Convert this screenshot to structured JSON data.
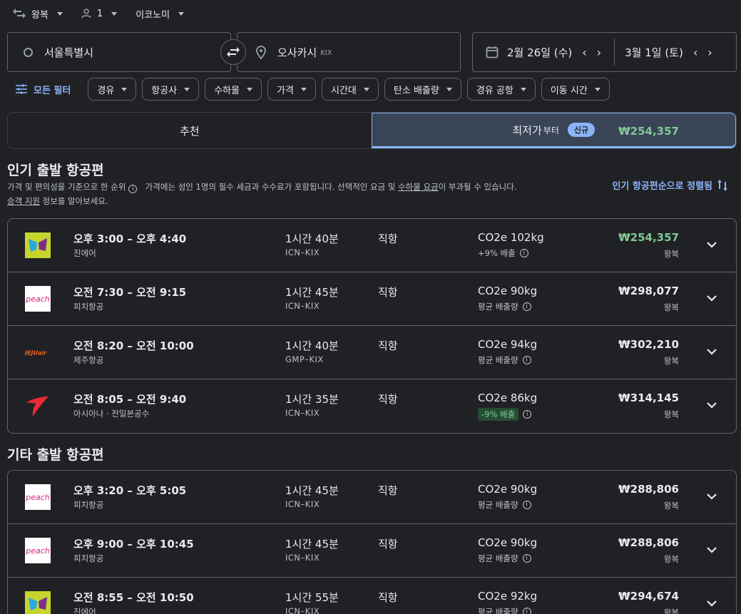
{
  "trip": {
    "type": "왕복",
    "passengers": "1",
    "cabin": "이코노미"
  },
  "search": {
    "origin": "서울특별시",
    "destination": "오사카시",
    "destination_code": "KIX",
    "depart_date": "2월 26일 (수)",
    "return_date": "3월 1일 (토)"
  },
  "filters": {
    "all": "모든 필터",
    "chips": [
      "경유",
      "항공사",
      "수하물",
      "가격",
      "시간대",
      "탄소 배출량",
      "경유 공항",
      "이동 시간"
    ]
  },
  "tabs": {
    "recommended": "추천",
    "cheapest": "최저가",
    "cheapest_price": "₩254,357",
    "cheapest_from": "부터",
    "new_badge": "신규"
  },
  "popular": {
    "title": "인기 출발 항공편",
    "sub_1": "가격 및 편의성을 기준으로 한 순위",
    "sub_2": "가격에는 성인 1명의 필수 세금과 수수료가 포함됩니다. 선택적인 요금 및",
    "sub_link_bag": "수하물 요금",
    "sub_3": "이 부과될 수 있습니다.",
    "sub_link_assist": "승객 지원",
    "sub_4": "정보를 알아보세요.",
    "sort": "인기 항공편순으로 정렬됨"
  },
  "other": {
    "title": "기타 출발 항공편"
  },
  "flights_popular": [
    {
      "times": "오후 3:00 – 오후 4:40",
      "airline": "진에어",
      "logo": "jinair",
      "duration": "1시간 40분",
      "route": "ICN–KIX",
      "stops": "직항",
      "co2": "CO2e 102kg",
      "co2_note": "+9% 배출",
      "price": "₩254,357",
      "price_type": "왕복",
      "green": true
    },
    {
      "times": "오전 7:30 – 오전 9:15",
      "airline": "피치항공",
      "logo": "peach",
      "duration": "1시간 45분",
      "route": "ICN–KIX",
      "stops": "직항",
      "co2": "CO2e 90kg",
      "co2_note": "평균 배출량",
      "price": "₩298,077",
      "price_type": "왕복"
    },
    {
      "times": "오전 8:20 – 오전 10:00",
      "airline": "제주항공",
      "logo": "jejuair",
      "duration": "1시간 40분",
      "route": "GMP–KIX",
      "stops": "직항",
      "co2": "CO2e 94kg",
      "co2_note": "평균 배출량",
      "price": "₩302,210",
      "price_type": "왕복"
    },
    {
      "times": "오전 8:05 – 오전 9:40",
      "airline": "아시아나 · 전일본공수",
      "logo": "asiana",
      "duration": "1시간 35분",
      "route": "ICN–KIX",
      "stops": "직항",
      "co2": "CO2e 86kg",
      "co2_note": "-9% 배출",
      "low": true,
      "price": "₩314,145",
      "price_type": "왕복"
    }
  ],
  "flights_other": [
    {
      "times": "오후 3:20 – 오후 5:05",
      "airline": "피치항공",
      "logo": "peach",
      "duration": "1시간 45분",
      "route": "ICN–KIX",
      "stops": "직항",
      "co2": "CO2e 90kg",
      "co2_note": "평균 배출량",
      "price": "₩288,806",
      "price_type": "왕복"
    },
    {
      "times": "오후 9:00 – 오후 10:45",
      "airline": "피치항공",
      "logo": "peach",
      "duration": "1시간 45분",
      "route": "ICN–KIX",
      "stops": "직항",
      "co2": "CO2e 90kg",
      "co2_note": "평균 배출량",
      "price": "₩288,806",
      "price_type": "왕복"
    },
    {
      "times": "오전 8:55 – 오전 10:50",
      "airline": "진에어",
      "logo": "jinair",
      "duration": "1시간 55분",
      "route": "ICN–KIX",
      "stops": "직항",
      "co2": "CO2e 92kg",
      "co2_note": "평균 배출량",
      "price": "₩294,674",
      "price_type": "왕복"
    }
  ]
}
